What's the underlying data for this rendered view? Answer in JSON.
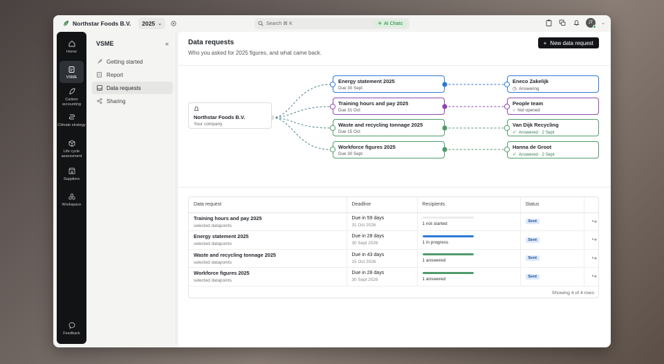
{
  "app": {
    "org_name": "Northstar Foods B.V.",
    "year": "2025",
    "search_placeholder": "Search ⌘ K",
    "ai_label": "AI Chats",
    "avatar_initials": "JT",
    "brand_color": "#2f7a3f"
  },
  "rail": {
    "items": [
      {
        "label": "Home",
        "icon": "home-icon"
      },
      {
        "label": "VSME",
        "icon": "clipboard-icon"
      },
      {
        "label": "Carbon accounting",
        "icon": "leaf-icon"
      },
      {
        "label": "Climate strategy",
        "icon": "route-icon"
      },
      {
        "label": "Life cycle assessment",
        "icon": "box-icon"
      },
      {
        "label": "Suppliers",
        "icon": "store-icon"
      },
      {
        "label": "Workspace",
        "icon": "nodes-icon"
      }
    ],
    "feedback": "Feedback"
  },
  "panel": {
    "title": "VSME",
    "items": [
      "Getting started",
      "Report",
      "Data requests",
      "Sharing"
    ]
  },
  "main": {
    "title": "Data requests",
    "subtitle": "Who you asked for 2025 figures, and what came back.",
    "new_button": "New data request"
  },
  "flow": {
    "source": {
      "name": "Northstar Foods B.V.",
      "sub": "Your company"
    },
    "requests": [
      {
        "title": "Energy statement 2025",
        "due": "Due 30 Sept",
        "color": "#2b78d6"
      },
      {
        "title": "Training hours and pay 2025",
        "due": "Due 31 Oct",
        "color": "#8e44ad"
      },
      {
        "title": "Waste and recycling tonnage 2025",
        "due": "Due 15 Oct",
        "color": "#4e9a6a"
      },
      {
        "title": "Workforce figures 2025",
        "due": "Due 30 Sept",
        "color": "#4e9a6a"
      }
    ],
    "recipients": [
      {
        "name": "Eneco Zakelijk",
        "status": "Answering",
        "icon": "clock-icon"
      },
      {
        "name": "People team",
        "status": "Not opened",
        "icon": "circle-icon"
      },
      {
        "name": "Van Dijk Recycling",
        "status": "Answered · 2 Sept",
        "icon": "check-icon"
      },
      {
        "name": "Hanna de Groot",
        "status": "Answered · 2 Sept",
        "icon": "check-icon"
      }
    ]
  },
  "table": {
    "headers": [
      "Data request",
      "Deadline",
      "Recipients",
      "Status"
    ],
    "rows": [
      {
        "title": "Training hours and pay 2025",
        "sub": "selected datapoints",
        "due": "Due in 59 days",
        "date": "31 Oct 2026",
        "recipients": "1 not started",
        "progress": 0,
        "bar_color": "#cfcfcf",
        "status": "Sent"
      },
      {
        "title": "Energy statement 2025",
        "sub": "selected datapoints",
        "due": "Due in 28 days",
        "date": "30 Sept 2026",
        "recipients": "1 in progress",
        "progress": 100,
        "bar_color": "#2b78d6",
        "status": "Sent"
      },
      {
        "title": "Waste and recycling tonnage 2025",
        "sub": "selected datapoints",
        "due": "Due in 43 days",
        "date": "15 Oct 2026",
        "recipients": "1 answered",
        "progress": 100,
        "bar_color": "#4e9a6a",
        "status": "Sent"
      },
      {
        "title": "Workforce figures 2025",
        "sub": "selected datapoints",
        "due": "Due in 28 days",
        "date": "30 Sept 2026",
        "recipients": "1 answered",
        "progress": 100,
        "bar_color": "#4e9a6a",
        "status": "Sent"
      }
    ],
    "footer": "Showing 4 of 4 rows"
  }
}
